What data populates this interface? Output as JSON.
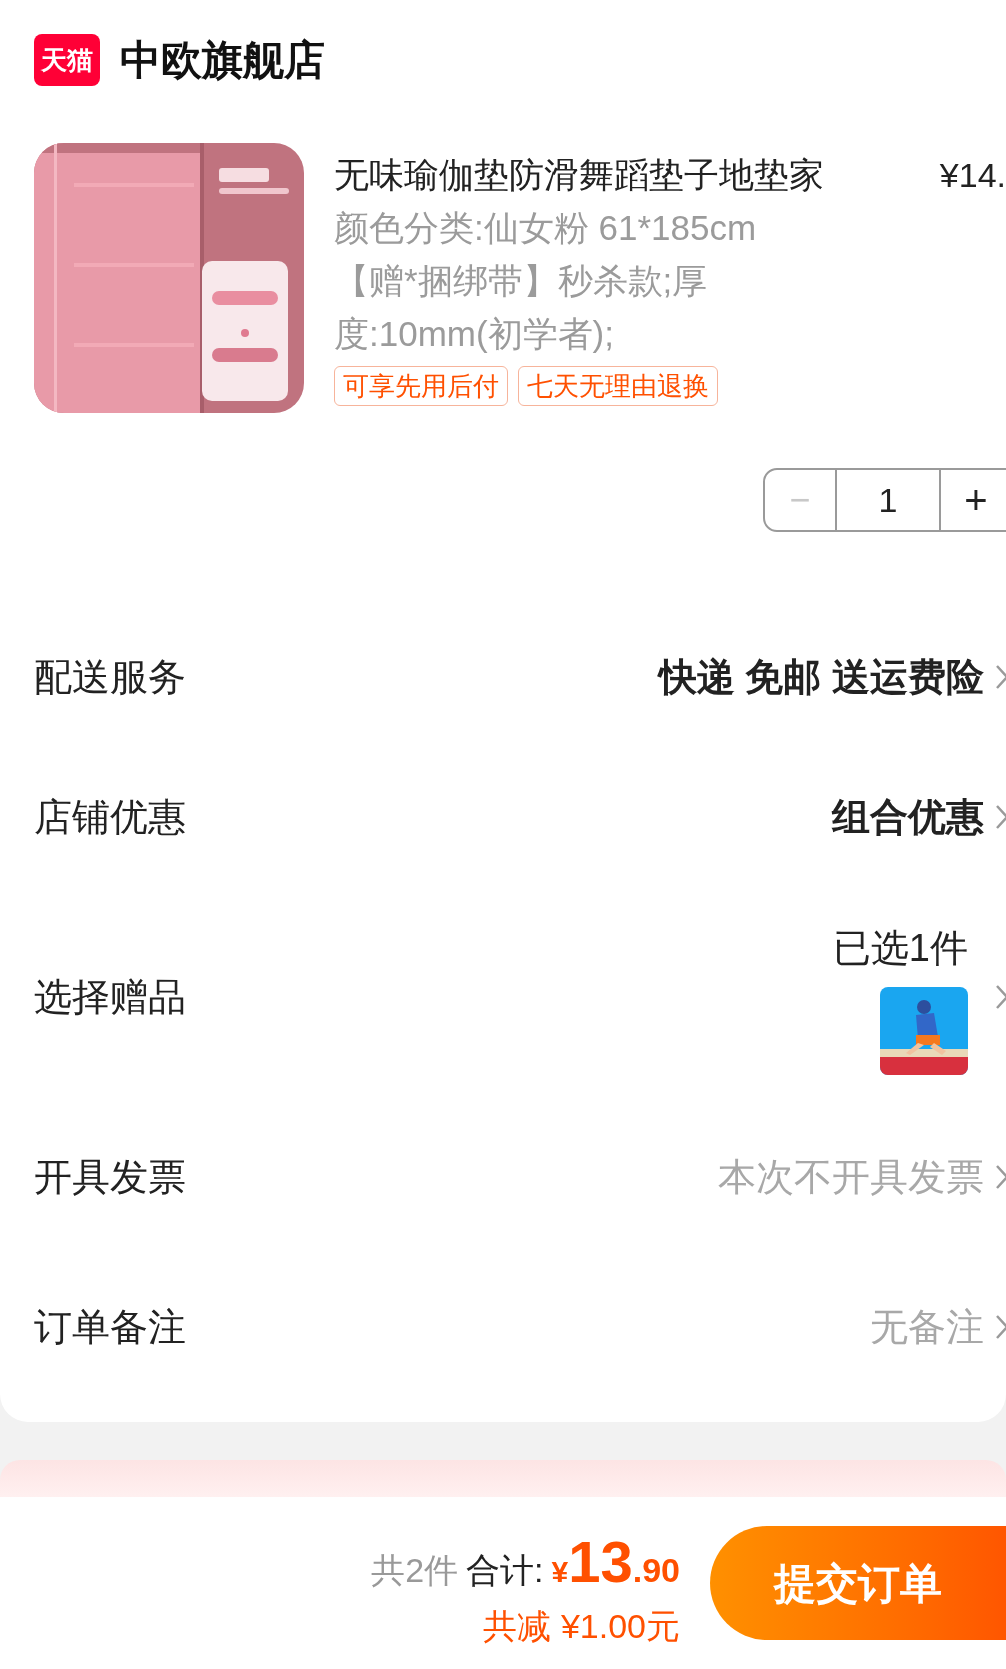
{
  "store": {
    "badge": "天猫",
    "name": "中欧旗舰店"
  },
  "product": {
    "kind": "picture",
    "title": "无味瑜伽垫防滑舞蹈垫子地垫家",
    "price": "¥14.",
    "spec": "颜色分类:仙女粉 61*185cm【赠*捆绑带】秒杀款;厚度:10mm(初学者);",
    "tags": [
      "可享先用后付",
      "七天无理由退换"
    ],
    "quantity": "1",
    "minus": "−",
    "plus": "+",
    "minus_disabled": true
  },
  "rows": [
    {
      "label": "配送服务",
      "value": "快递 免邮 送运费险",
      "kind": "text",
      "bold": true,
      "greyed": false
    },
    {
      "label": "店铺优惠",
      "value": "组合优惠",
      "kind": "text",
      "bold": true,
      "greyed": false
    },
    {
      "label": "选择赠品",
      "value": "已选1件",
      "kind": "gift",
      "bold": false,
      "greyed": false
    },
    {
      "label": "开具发票",
      "value": "本次不开具发票",
      "kind": "text",
      "bold": false,
      "greyed": true
    },
    {
      "label": "订单备注",
      "value": "无备注",
      "kind": "text",
      "bold": false,
      "greyed": true
    }
  ],
  "footer": {
    "count": "共2件",
    "total_label": "合计:",
    "currency": "¥",
    "total_int": "13",
    "total_dec": ".90",
    "discount": "共减 ¥1.00元",
    "submit": "提交订单"
  }
}
